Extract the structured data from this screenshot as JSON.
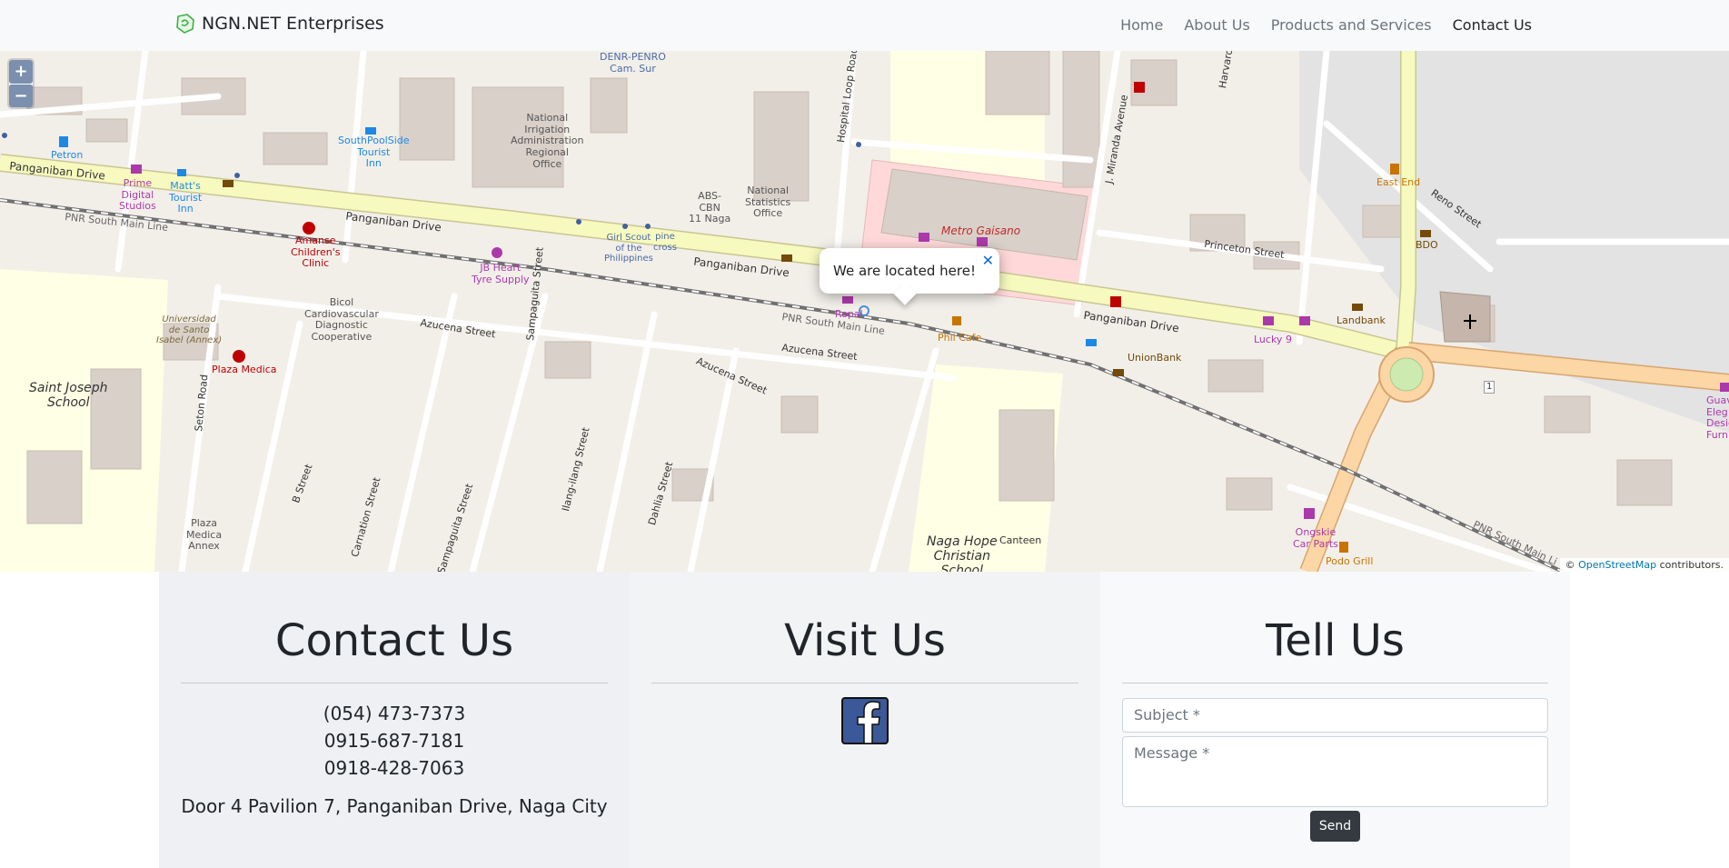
{
  "navbar": {
    "brand": "NGN.NET Enterprises",
    "links": [
      "Home",
      "About Us",
      "Products and Services",
      "Contact Us"
    ],
    "active": "Contact Us"
  },
  "map": {
    "zoom_in": "+",
    "zoom_out": "−",
    "popup_text": "We are located here!",
    "popup_close": "✕",
    "attribution_prefix": "©",
    "attribution_link": "OpenStreetMap",
    "attribution_suffix": "contributors.",
    "labels": {
      "denr": "DENR-PENRO\nCam. Sur",
      "nia": "National\nIrrigation\nAdministration\nRegional\nOffice",
      "southpoolside": "SouthPoolSide\nTourist\nInn",
      "petron": "Petron",
      "prime_digital": "Prime\nDigital\nStudios",
      "matts": "Matt's\nTourist\nInn",
      "panganiban_1": "Panganiban Drive",
      "panganiban_2": "Panganiban Drive",
      "panganiban_3": "Panganiban Drive",
      "panganiban_4": "Panganiban Drive",
      "pnr_1": "PNR South Main Line",
      "pnr_2": "PNR South Main Line",
      "pnr_3": "PNR South Main Li",
      "abs_cbn": "ABS-\nCBN\n11 Naga",
      "nso": "National\nStatistics\nOffice",
      "girl_scout": "Girl Scout\nof the\nPhilippines",
      "pine_cross": "pine\ncross",
      "hospital_loop": "Hospital Loop Road",
      "metro_gaisano": "Metro Gaisano",
      "miranda": "J. Miranda Avenue",
      "harvard": "Harvard",
      "east_end": "East End",
      "reno": "Reno Street",
      "bdo": "BDO",
      "princeton": "Princeton Street",
      "landbank": "Landbank",
      "lucky9": "Lucky 9",
      "unionbank": "UnionBank",
      "phil_cafe": "Phil Cafe",
      "ropal": "Ropal",
      "amanse": "Amanse\nChildren's\nClinic",
      "jb_heart": "JB Heart\nTyre Supply",
      "sampaguita_1": "Sampaguita Street",
      "sampaguita_2": "Sampaguita Street",
      "azucena_1": "Azucena Street",
      "azucena_2": "Azucena Street",
      "azucena_3": "Azucena Street",
      "bicol": "Bicol\nCardiovascular\nDiagnostic\nCooperative",
      "usi": "Universidad\nde Santo\nIsabel (Annex)",
      "plaza_medica": "Plaza Medica",
      "saint_joseph": "Saint Joseph\nSchool",
      "seton": "Seton Road",
      "b_street": "B Street",
      "carnation": "Carnation Street",
      "ilang_ilang": "Ilang-ilang Street",
      "dahlia": "Dahlia Street",
      "plaza_medica_annex": "Plaza\nMedica\nAnnex",
      "naga_hope": "Naga Hope\nChristian\nSchool",
      "canteen": "Canteen",
      "ongskie": "Ongskie\nCar Parts",
      "podo": "Podo Grill",
      "guava": "Guava\nEleg\nDesig\nFurnit",
      "route_1": "1"
    }
  },
  "contact": {
    "heading": "Contact Us",
    "phones": [
      "(054) 473-7373",
      "0915-687-7181",
      "0918-428-7063"
    ],
    "address": "Door 4 Pavilion 7, Panganiban Drive, Naga City"
  },
  "visit": {
    "heading": "Visit Us",
    "facebook_icon": "facebook-icon"
  },
  "tell": {
    "heading": "Tell Us",
    "subject_placeholder": "Subject *",
    "message_placeholder": "Message *",
    "send_label": "Send"
  },
  "colors": {
    "navbar_bg": "#f8f9fa",
    "map_bg": "#f2efe9",
    "primary_road": "#f7fabf",
    "trunk_road": "#fcd6a4",
    "building": "#d9d0c9",
    "school": "#ffffe5",
    "hospital": "#ffd9d9",
    "send_button": "#343a40",
    "facebook_blue": "#3b5998"
  }
}
